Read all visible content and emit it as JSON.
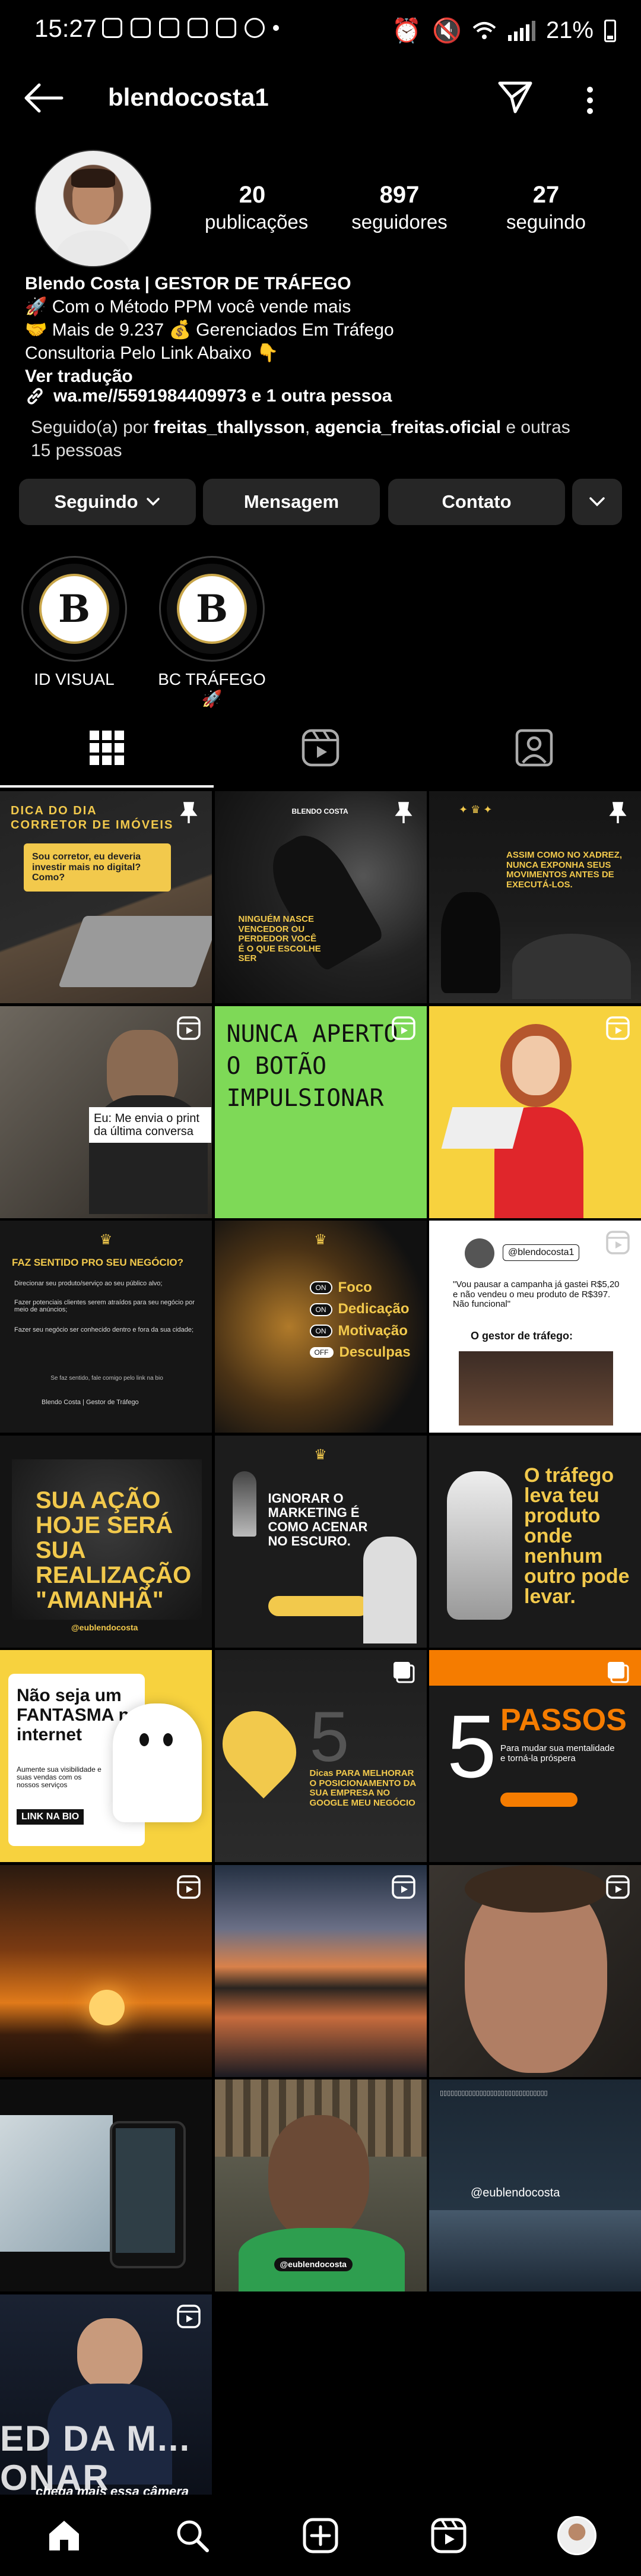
{
  "status": {
    "time": "15:27",
    "signal": "21%"
  },
  "header": {
    "username": "blendocosta1"
  },
  "stats": [
    {
      "num": "20",
      "label": "publicações"
    },
    {
      "num": "897",
      "label": "seguidores"
    },
    {
      "num": "27",
      "label": "seguindo"
    }
  ],
  "bio": {
    "name": "Blendo Costa  | GESTOR DE TRÁFEGO",
    "line1": "🚀 Com o Método PPM você vende mais",
    "line2": "🤝 Mais de 9.237 💰 Gerenciados Em Tráfego",
    "line3": "Consultoria Pelo Link Abaixo 👇",
    "translate": "Ver tradução",
    "link": "wa.me//5591984409973 e 1 outra pessoa"
  },
  "followed": {
    "prefix": "Seguido(a) por ",
    "user1": "freitas_thallysson",
    "sep": ", ",
    "user2": "agencia_freitas.oficial",
    "suffix": " e outras 15 pessoas"
  },
  "buttons": {
    "following": "Seguindo",
    "message": "Mensagem",
    "contact": "Contato"
  },
  "highlights": [
    {
      "label": "ID VISUAL",
      "logo": "B"
    },
    {
      "label": "BC TRÁFEGO 🚀",
      "logo": "B"
    }
  ],
  "posts": {
    "p1_title": "DICA DO DIA",
    "p1_sub": "CORRETOR DE IMÓVEIS",
    "p1_q": "Sou corretor, eu deveria investir mais no digital? Como?",
    "p2_brand": "BLENDO COSTA",
    "p2_text": "NINGUÉM NASCE VENCEDOR OU PERDEDOR VOCÊ É O QUE ESCOLHE SER",
    "p3_text": "ASSIM COMO NO XADREZ, NUNCA EXPONHA SEUS MOVIMENTOS ANTES DE EXECUTÁ-LOS.",
    "p4_text": "Eu: Me envia o print da última conversa",
    "p5_text": "NUNCA APERTO O BOTÃO IMPULSIONAR",
    "p7_title": "FAZ SENTIDO PRO SEU NEGÓCIO?",
    "p7_b1": "Direcionar seu produto/serviço ao seu público alvo;",
    "p7_b2": "Fazer potenciais clientes serem atraídos para seu negócio por meio de anúncios;",
    "p7_b3": "Fazer seu negócio ser conhecido dentro e fora da sua cidade;",
    "p7_foot": "Se faz sentido, fale comigo pelo link na bio",
    "p7_sig": "Blendo Costa | Gestor de Tráfego",
    "p8_items": [
      "Foco",
      "Dedicação",
      "Motivação",
      "Desculpas"
    ],
    "p9_user": "@blendocosta1",
    "p9_quote": "\"Vou pausar a campanha já gastei R$5,20 e não vendeu o meu produto de R$397. Não funcional\"",
    "p9_label": "O gestor de tráfego:",
    "p10_text": "SUA AÇÃO HOJE SERÁ SUA REALIZAÇÃO \"AMANHÃ\"",
    "p10_handle": "@eublendocosta",
    "p11_text": "IGNORAR O MARKETING É COMO ACENAR NO ESCURO.",
    "p12_text": "O tráfego leva teu produto onde nenhum outro pode levar.",
    "p13_text": "Não seja um FANTASMA na internet",
    "p13_sub": "Aumente sua visibilidade e suas vendas com os nossos serviços",
    "p13_cta": "LINK NA BIO",
    "p14_num": "5",
    "p14_text": "Dicas PARA MELHORAR O POSICIONAMENTO DA SUA EMPRESA NO GOOGLE MEU NEGÓCIO",
    "p15_num": "5",
    "p15_title": "PASSOS",
    "p15_sub": "Para mudar sua mentalidade e torná-la próspera",
    "p19_handle": "@eublendocosta",
    "p20_handle": "@eublendocosta",
    "p22_text": "chega mais essa câmera"
  }
}
